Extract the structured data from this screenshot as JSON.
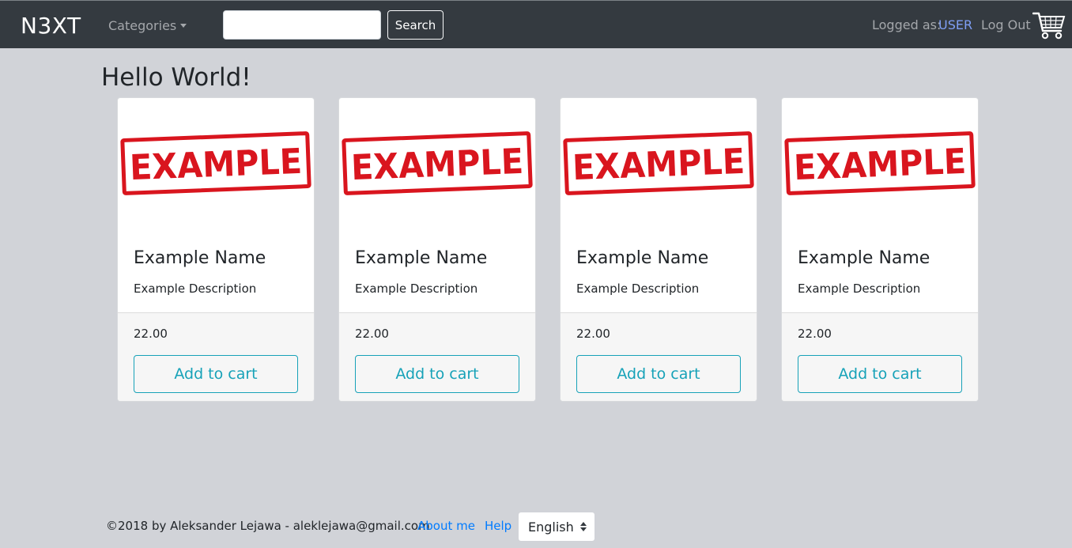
{
  "navbar": {
    "brand": "N3XT",
    "categories_label": "Categories",
    "search_value": "",
    "search_button": "Search",
    "logged_as_label": "Logged as:",
    "username": "USER",
    "logout_label": "Log Out",
    "cart_icon": "shopping-cart-icon"
  },
  "main": {
    "title": "Hello World!",
    "products": [
      {
        "image_text": "EXAMPLE",
        "name": "Example Name",
        "description": "Example Description",
        "price": "22.00",
        "button": "Add to cart"
      },
      {
        "image_text": "EXAMPLE",
        "name": "Example Name",
        "description": "Example Description",
        "price": "22.00",
        "button": "Add to cart"
      },
      {
        "image_text": "EXAMPLE",
        "name": "Example Name",
        "description": "Example Description",
        "price": "22.00",
        "button": "Add to cart"
      },
      {
        "image_text": "EXAMPLE",
        "name": "Example Name",
        "description": "Example Description",
        "price": "22.00",
        "button": "Add to cart"
      }
    ]
  },
  "footer": {
    "copyright": "©2018 by Aleksander Lejawa - aleklejawa@gmail.com",
    "about_link": "About me",
    "help_link": "Help",
    "language_selected": "English"
  },
  "colors": {
    "navbar_bg": "#343a40",
    "page_bg": "#d1d3d8",
    "accent_info": "#17a2b8",
    "link": "#007bff",
    "stamp_red": "#d9151e"
  }
}
